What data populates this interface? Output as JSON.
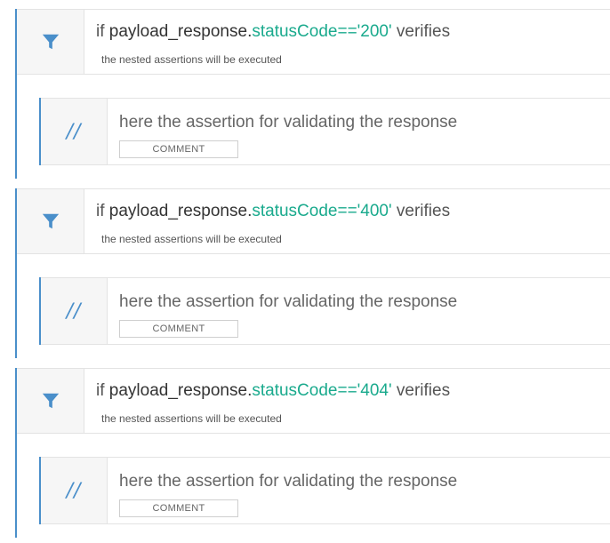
{
  "blocks": [
    {
      "if_prefix": "if ",
      "variable": "payload_response.",
      "condition": "statusCode=='200'",
      "if_suffix": " verifies",
      "subtitle": "the nested assertions will be executed",
      "comment_icon": "//",
      "comment_text": "here the assertion for validating the response",
      "comment_badge": "COMMENT"
    },
    {
      "if_prefix": "if ",
      "variable": "payload_response.",
      "condition": "statusCode=='400'",
      "if_suffix": " verifies",
      "subtitle": "the nested assertions will be executed",
      "comment_icon": "//",
      "comment_text": "here the assertion for validating the response",
      "comment_badge": "COMMENT"
    },
    {
      "if_prefix": "if ",
      "variable": "payload_response.",
      "condition": "statusCode=='404'",
      "if_suffix": " verifies",
      "subtitle": "the nested assertions will be executed",
      "comment_icon": "//",
      "comment_text": "here the assertion for validating the response",
      "comment_badge": "COMMENT"
    }
  ],
  "icons": {
    "if_step": "filter-icon",
    "comment_step": "comment-slashes-icon"
  },
  "colors": {
    "accent_blue": "#4a8fca",
    "condition_green": "#1aaa8d"
  }
}
